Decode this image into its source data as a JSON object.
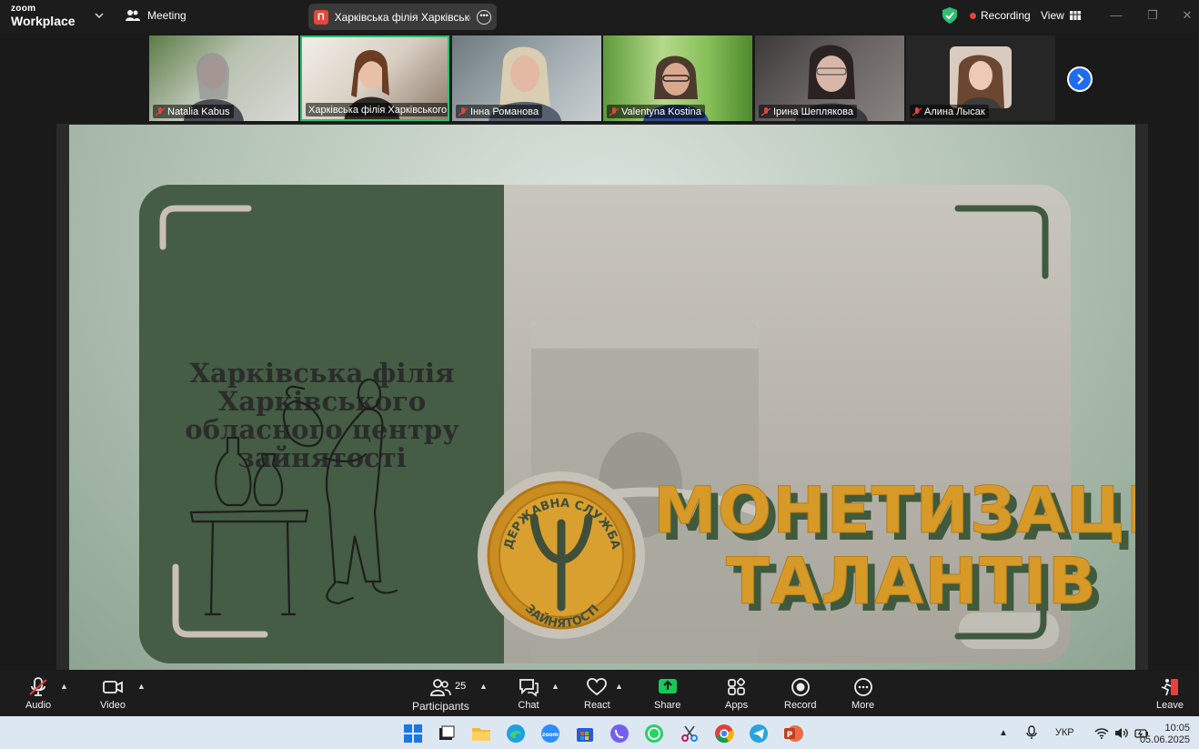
{
  "app": {
    "brand_top": "zoom",
    "brand_bottom": "Workplace",
    "meeting_label": "Meeting"
  },
  "meeting": {
    "badge_letter": "П",
    "title": "Харківська філія Харківського с"
  },
  "status": {
    "recording": "Recording",
    "view": "View"
  },
  "participants": [
    {
      "name": "Natalia Kabus",
      "muted": true
    },
    {
      "name": "Харківська філія Харківського ...",
      "muted": false,
      "active": true
    },
    {
      "name": "Інна Романова",
      "muted": true
    },
    {
      "name": "Valentyna Kostina",
      "muted": true
    },
    {
      "name": "Ірина Шеплякова",
      "muted": true
    },
    {
      "name": "Алина Лысак",
      "muted": true
    }
  ],
  "slide": {
    "org_title": "Харківська філія Харківського обласного центру зайнятості",
    "headline_line1": "МОНЕТИЗАЦІЯ",
    "headline_line2": "ТАЛАНТІВ",
    "emblem_top": "ДЕРЖАВНА СЛУЖБА",
    "emblem_bottom": "ЗАЙНЯТОСТІ"
  },
  "toolbar": {
    "audio": "Audio",
    "video": "Video",
    "participants": "Participants",
    "participants_count": "25",
    "chat": "Chat",
    "react": "React",
    "share": "Share",
    "apps": "Apps",
    "record": "Record",
    "more": "More",
    "leave": "Leave"
  },
  "taskbar": {
    "language": "УКР",
    "time": "10:05",
    "date": "05.06.2025"
  },
  "colors": {
    "accent_green": "#2dbe72",
    "share_green": "#17c85a",
    "recording_red": "#e8413b",
    "slide_green": "#445d44",
    "headline_gold": "#d79a28",
    "next_blue": "#1e6cf0"
  }
}
